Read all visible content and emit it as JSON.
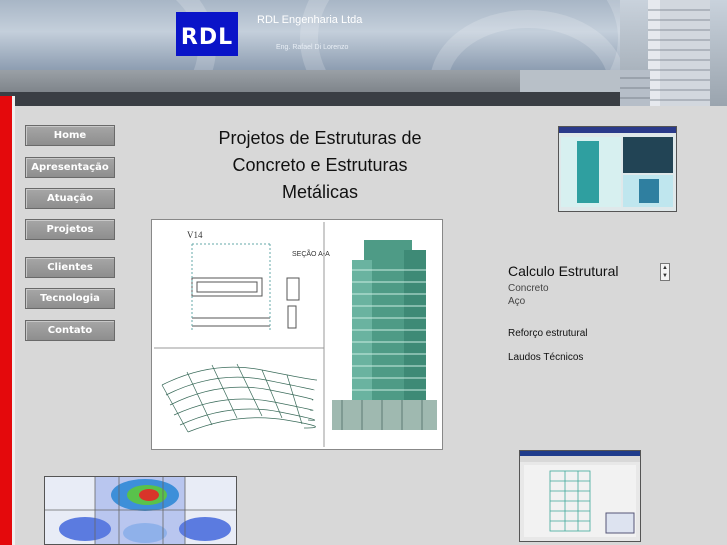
{
  "header": {
    "logo_text": "RDL",
    "company_name": "RDL Engenharia Ltda",
    "engineer_name": "Eng. Rafael Di Lorenzo",
    "logo_color": "#0a14c8"
  },
  "nav": {
    "items": [
      {
        "label": "Home"
      },
      {
        "label": "Apresentação"
      },
      {
        "label": "Atuação"
      },
      {
        "label": "Projetos"
      },
      {
        "label": "Clientes"
      },
      {
        "label": "Tecnologia"
      },
      {
        "label": "Contato"
      }
    ]
  },
  "main": {
    "title_line1": "Projetos de Estruturas de",
    "title_line2": "Concreto e Estruturas",
    "title_line3": "Metálicas",
    "main_image_icon": "structural-drawings-and-3d-building-model"
  },
  "side": {
    "calc_title": "Calculo Estrutural",
    "sub_items": [
      "Concreto",
      "Aço"
    ],
    "link_reforco": "Reforço estrutural",
    "link_laudos": "Laudos Técnicos",
    "scroll_up_icon": "arrow-up-icon",
    "scroll_down_icon": "arrow-down-icon"
  },
  "colors": {
    "accent_red": "#e4090c",
    "nav_button": "#9a9a9a",
    "dark_bar": "#3a3e44"
  }
}
